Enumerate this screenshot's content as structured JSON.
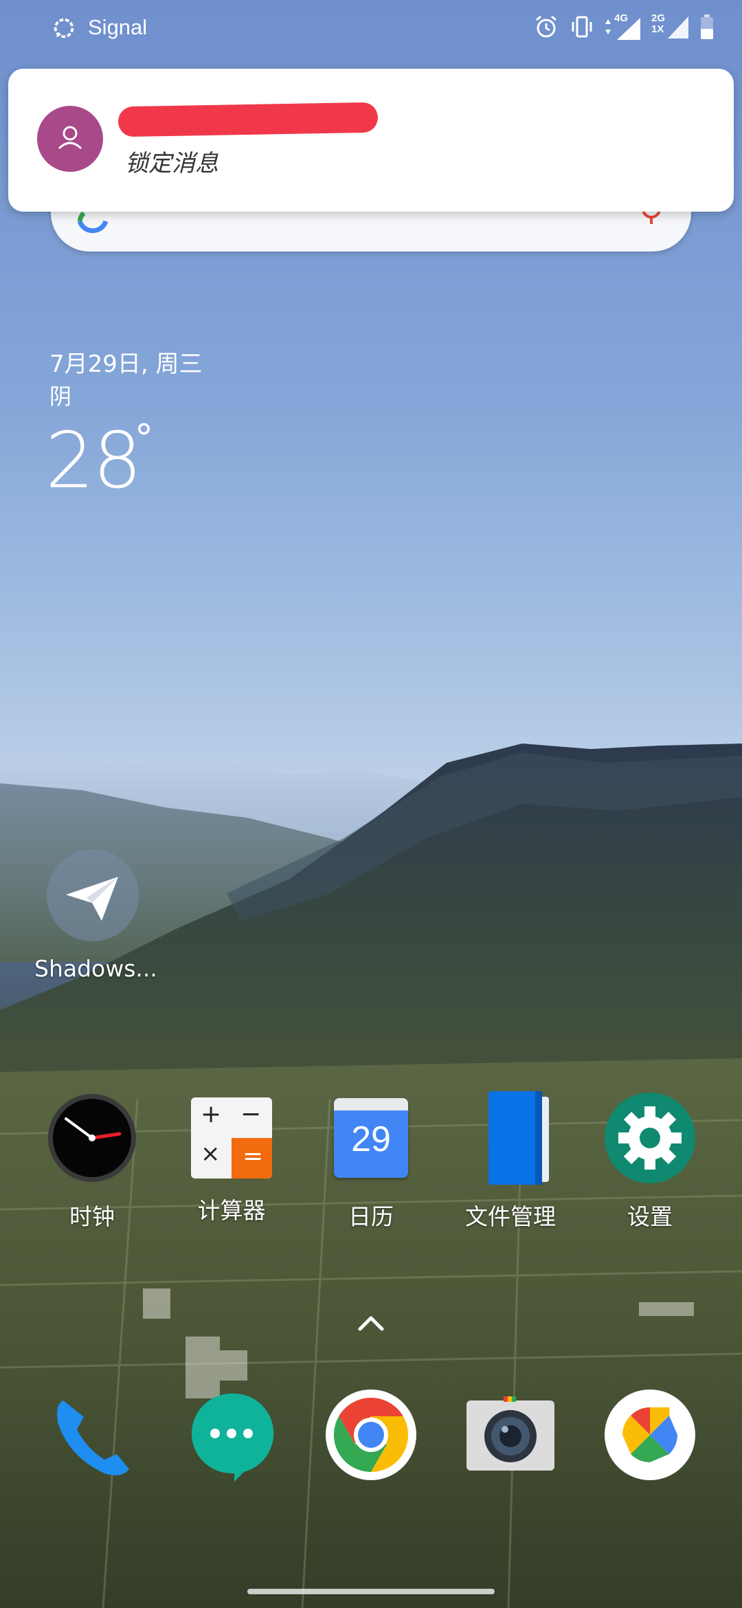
{
  "status_bar": {
    "app_name": "Signal",
    "net_top": "4G",
    "net_bottom_1": "2G",
    "net_bottom_2": "1X"
  },
  "notification": {
    "message": "锁定消息"
  },
  "weather": {
    "date": "7月29日, 周三",
    "condition": "阴",
    "temperature": "28",
    "degree_symbol": "°"
  },
  "desktop": {
    "shortcut_label": "Shadows..."
  },
  "apps_row": [
    {
      "label": "时钟",
      "icon": "clock-icon"
    },
    {
      "label": "计算器",
      "icon": "calculator-icon"
    },
    {
      "label": "日历",
      "icon": "calendar-icon",
      "day": "29"
    },
    {
      "label": "文件管理",
      "icon": "file-manager-icon"
    },
    {
      "label": "设置",
      "icon": "settings-icon"
    }
  ],
  "dock": [
    {
      "icon": "phone-icon"
    },
    {
      "icon": "messages-icon"
    },
    {
      "icon": "chrome-icon"
    },
    {
      "icon": "camera-icon"
    },
    {
      "icon": "photos-icon"
    }
  ],
  "calculator": {
    "plus": "+",
    "minus": "−",
    "times": "×",
    "equals": "="
  }
}
